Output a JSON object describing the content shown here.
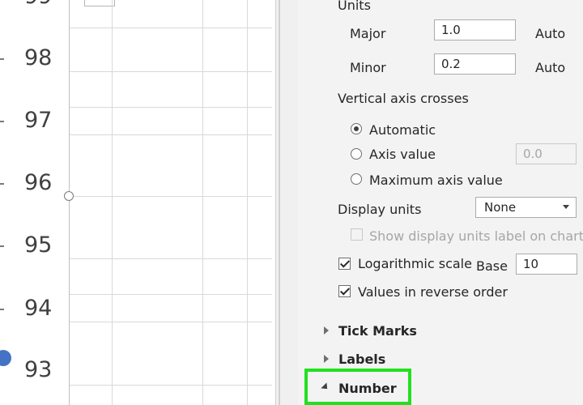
{
  "chart": {
    "tick_labels": [
      "99",
      "98",
      "97",
      "96",
      "95",
      "94",
      "93"
    ],
    "colors": {
      "series_marker": "#4472c4",
      "gridline": "#d9d9d9"
    }
  },
  "pane": {
    "units_heading": "Units",
    "major_label": "Major",
    "major_value": "1.0",
    "major_auto": "Auto",
    "minor_label": "Minor",
    "minor_value": "0.2",
    "minor_auto": "Auto",
    "crosses_heading": "Vertical axis crosses",
    "radio_automatic": "Automatic",
    "radio_axis_value": "Axis value",
    "axis_value_input": "0.0",
    "radio_maximum": "Maximum axis value",
    "display_units_label": "Display units",
    "display_units_value": "None",
    "show_units_label": "Show display units label on chart",
    "log_scale_label": "Logarithmic scale",
    "base_label": "Base",
    "base_value": "10",
    "reverse_order_label": "Values in reverse order",
    "section_tick_marks": "Tick Marks",
    "section_labels": "Labels",
    "section_number": "Number",
    "highlight_color": "#22e01f"
  }
}
